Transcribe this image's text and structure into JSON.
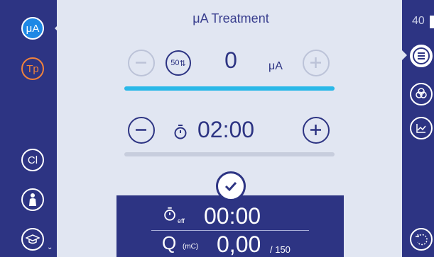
{
  "left_sidebar": {
    "tabs": [
      {
        "label": "μA",
        "active": true
      },
      {
        "label": "Tp",
        "color": "#f0823c"
      },
      {
        "label": "Cl"
      },
      {
        "label": "",
        "icon": "body-icon"
      },
      {
        "label": "",
        "icon": "graduation-cap-icon"
      }
    ]
  },
  "treatment": {
    "title": "μA Treatment",
    "current": {
      "value": "0",
      "unit": "μA",
      "step_label": "50",
      "level_fraction": 1.0,
      "accent": "#2ab8e8"
    },
    "time": {
      "value": "02:00",
      "level_fraction": 0.0
    }
  },
  "status": {
    "elapsed_label": "eff",
    "elapsed_value": "00:00",
    "charge_label": "Q",
    "charge_unit": "(mC)",
    "charge_value": "0,00",
    "charge_limit": "/ 150"
  },
  "right_sidebar": {
    "value": "40"
  },
  "colors": {
    "primary": "#2d3483",
    "background": "#e1e6f2",
    "accent": "#2ab8e8",
    "active_tab": "#1e88e5",
    "orange": "#f0823c"
  }
}
